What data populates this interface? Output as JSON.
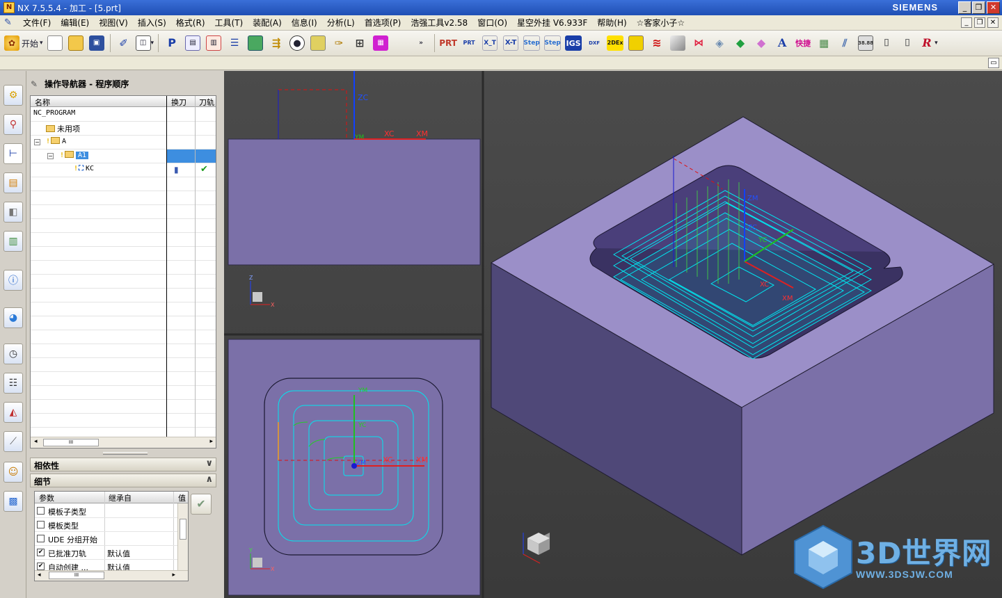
{
  "window": {
    "title": "NX 7.5.5.4 - 加工 - [5.prt]",
    "brand": "SIEMENS",
    "buttons": {
      "minimize": "_",
      "restore": "❐",
      "close": "✕"
    }
  },
  "menu": {
    "items": [
      "文件(F)",
      "编辑(E)",
      "视图(V)",
      "插入(S)",
      "格式(R)",
      "工具(T)",
      "装配(A)",
      "信息(I)",
      "分析(L)",
      "首选项(P)",
      "浩强工具v2.58",
      "窗口(O)",
      "星空外挂 V6.933F",
      "帮助(H)",
      "☆客家小子☆"
    ]
  },
  "toolbar": {
    "start_label": "开始",
    "dropdown_glyph": "▾",
    "overflow_glyph": "»",
    "left_icons": [
      "new-file-icon",
      "open-file-icon",
      "save-icon",
      "edit-icon",
      "layout-icon"
    ],
    "mid_icons": [
      "nc-program-icon",
      "create-operation-icon",
      "create-tool-icon",
      "create-geometry-icon",
      "create-method-icon",
      "generate-path-icon",
      "panda-icon",
      "post-icon",
      "tools-icon",
      "shop-doc-icon",
      "magenta-grid-icon"
    ],
    "right_icons": [
      {
        "name": "prt-export-icon",
        "label": "PRT",
        "color": "#c0392b"
      },
      {
        "name": "prt-arrow-icon",
        "label": "PRT",
        "color": "#1a3ea8"
      },
      {
        "name": "xt-export-icon",
        "label": "X_T",
        "color": "#1a3ea8"
      },
      {
        "name": "xt-convert-icon",
        "label": "X-T",
        "color": "#1a3ea8"
      },
      {
        "name": "step-export-icon",
        "label": "Step",
        "color": "#2a6fd0"
      },
      {
        "name": "step-convert-icon",
        "label": "Step",
        "color": "#2a6fd0"
      },
      {
        "name": "igs-export-icon",
        "label": "IGS",
        "color": "#ffffff"
      },
      {
        "name": "dxf-export-icon",
        "label": "DXF",
        "color": "#1a3ea8"
      },
      {
        "name": "2dex-icon",
        "label": "2DEx",
        "color": "#1a1a1a"
      },
      {
        "name": "yellow-box-icon",
        "label": "",
        "color": "#f0d000"
      },
      {
        "name": "red-spring-icon",
        "label": "",
        "color": "#d01010"
      },
      {
        "name": "surface-icon",
        "label": "",
        "color": "#c8c8c8"
      },
      {
        "name": "red-mesh-icon",
        "label": "",
        "color": "#e02040"
      },
      {
        "name": "layer-icon",
        "label": "",
        "color": "#6a8ab0"
      },
      {
        "name": "green-cube-icon",
        "label": "",
        "color": "#20a040"
      },
      {
        "name": "pink-cube-icon",
        "label": "",
        "color": "#d070d0"
      },
      {
        "name": "text-a-icon",
        "label": "A",
        "color": "#1a3ea8"
      },
      {
        "name": "quick-label-icon",
        "label": "快捷",
        "color": "#d01090"
      },
      {
        "name": "sheet-icon",
        "label": "",
        "color": "#4a8a4a"
      },
      {
        "name": "graph-icon",
        "label": "",
        "color": "#4a70b0"
      },
      {
        "name": "counter-icon",
        "label": "38.88",
        "color": "#333333"
      },
      {
        "name": "tool-1-icon",
        "label": "",
        "color": "#666666"
      },
      {
        "name": "tool-2-icon",
        "label": "",
        "color": "#666666"
      },
      {
        "name": "r-icon",
        "label": "R",
        "color": "#c0102a"
      }
    ]
  },
  "resource_bar_icons": [
    "assembly-navigator-icon",
    "constraint-navigator-icon",
    "operation-navigator-icon",
    "reuse-library-icon",
    "web-browser-icon",
    "history-icon",
    "info-icon",
    "process-studio-icon",
    "clock-icon",
    "templates-icon",
    "palette-icon",
    "rulers-icon",
    "roles-icon",
    "system-scenes-icon"
  ],
  "navigator": {
    "title": "操作导航器 - 程序顺序",
    "columns": [
      "名称",
      "换刀",
      "刀轨"
    ],
    "rows": [
      {
        "label": "NC_PROGRAM"
      },
      {
        "label": "未用项"
      },
      {
        "label": "A",
        "expander": "−"
      },
      {
        "label": "A1",
        "expander": "−"
      },
      {
        "label": "KC",
        "toolchange": "▮",
        "path_ok": "✔"
      }
    ],
    "scroll_thumb": "III",
    "scroll_left": "◂",
    "scroll_right": "▸"
  },
  "dependency": {
    "title": "相依性",
    "chevron": "∨"
  },
  "details": {
    "title": "细节",
    "chevron": "∧",
    "columns": [
      "参数",
      "继承自",
      "值"
    ],
    "rows": [
      {
        "param": "模板子类型",
        "checked": false,
        "inherit": ""
      },
      {
        "param": "模板类型",
        "checked": false,
        "inherit": ""
      },
      {
        "param": "UDE 分组开始",
        "checked": false,
        "inherit": ""
      },
      {
        "param": "已批准刀轨",
        "checked": true,
        "inherit": "默认值"
      },
      {
        "param": "自动创建 ...",
        "checked": true,
        "inherit": "默认值"
      }
    ],
    "scroll_thumb": "III",
    "ok_glyph": "✔"
  },
  "viewports": {
    "front": {
      "labels": {
        "zc": "ZC",
        "xc": "XC",
        "xm": "XM",
        "ym": "YM"
      }
    },
    "top": {
      "labels": {
        "ym": "YM",
        "yc": "YC",
        "xc": "XC",
        "xm": "XM",
        "zm": "ZM"
      }
    },
    "iso": {
      "labels": {
        "zm": "ZM",
        "zc": "ZC",
        "yc": "YC",
        "xc": "XC",
        "xm": "XM"
      }
    },
    "triad": {
      "z": "Z",
      "y": "Y",
      "x": "X"
    }
  },
  "watermark": {
    "text": "3D世界网",
    "url": "WWW.3DSJW.COM"
  },
  "colors": {
    "part_face": "#7b70a8",
    "part_top": "#9b8fc8",
    "part_side_dark": "#4f4878",
    "toolpath": "#00e6f0",
    "highlight": "#3d8ee0"
  }
}
